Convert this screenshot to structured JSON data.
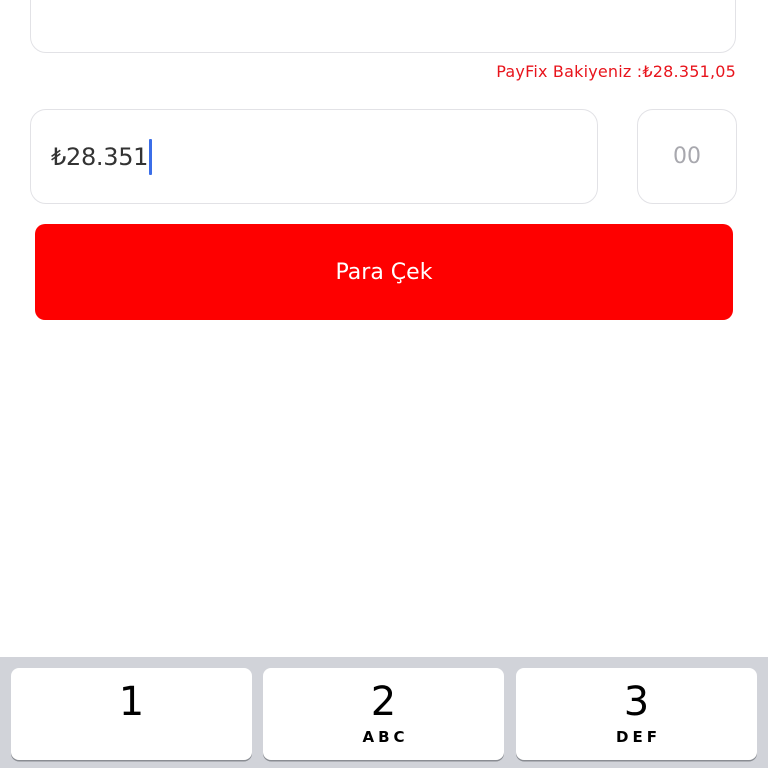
{
  "balance": {
    "text": "PayFix Bakiyeniz :₺28.351,05"
  },
  "amount": {
    "value": "₺28.351"
  },
  "cents": {
    "placeholder": "00"
  },
  "actions": {
    "withdraw_label": "Para Çek",
    "withdraw_color": "#fe0000"
  },
  "keyboard": {
    "keys": [
      {
        "digit": "1",
        "letters": ""
      },
      {
        "digit": "2",
        "letters": "ABC"
      },
      {
        "digit": "3",
        "letters": "DEF"
      }
    ]
  }
}
